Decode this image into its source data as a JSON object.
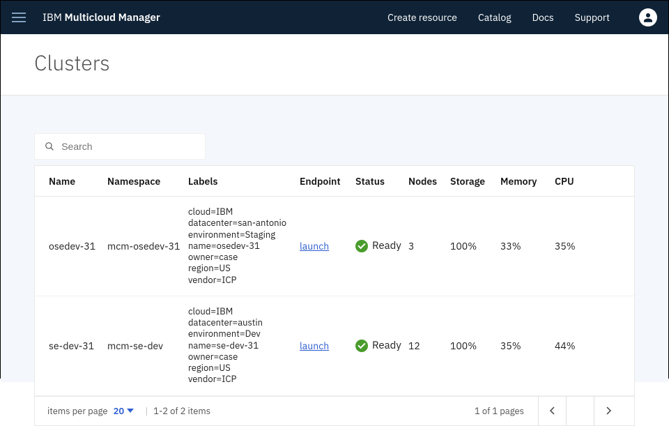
{
  "header": {
    "brand_prefix": "IBM ",
    "brand_main": "Multicloud Manager",
    "nav": [
      "Create resource",
      "Catalog",
      "Docs",
      "Support"
    ]
  },
  "page": {
    "title": "Clusters"
  },
  "search": {
    "placeholder": "Search"
  },
  "table": {
    "columns": [
      "Name",
      "Namespace",
      "Labels",
      "Endpoint",
      "Status",
      "Nodes",
      "Storage",
      "Memory",
      "CPU"
    ],
    "rows": [
      {
        "name": "osedev-31",
        "namespace": "mcm-osedev-31",
        "labels": "cloud=IBM\ndatacenter=san-antonio\nenvironment=Staging\nname=osedev-31\nowner=case\nregion=US\nvendor=ICP",
        "endpoint": "launch",
        "status": "Ready",
        "nodes": "3",
        "storage": "100%",
        "memory": "33%",
        "cpu": "35%"
      },
      {
        "name": "se-dev-31",
        "namespace": "mcm-se-dev",
        "labels": "cloud=IBM\ndatacenter=austin\nenvironment=Dev\nname=se-dev-31\nowner=case\nregion=US\nvendor=ICP",
        "endpoint": "launch",
        "status": "Ready",
        "nodes": "12",
        "storage": "100%",
        "memory": "35%",
        "cpu": "44%"
      }
    ]
  },
  "pagination": {
    "items_per_page_label": "items per page",
    "items_per_page_value": "20",
    "range_text": "1-2 of 2 items",
    "page_text": "1 of 1 pages"
  }
}
